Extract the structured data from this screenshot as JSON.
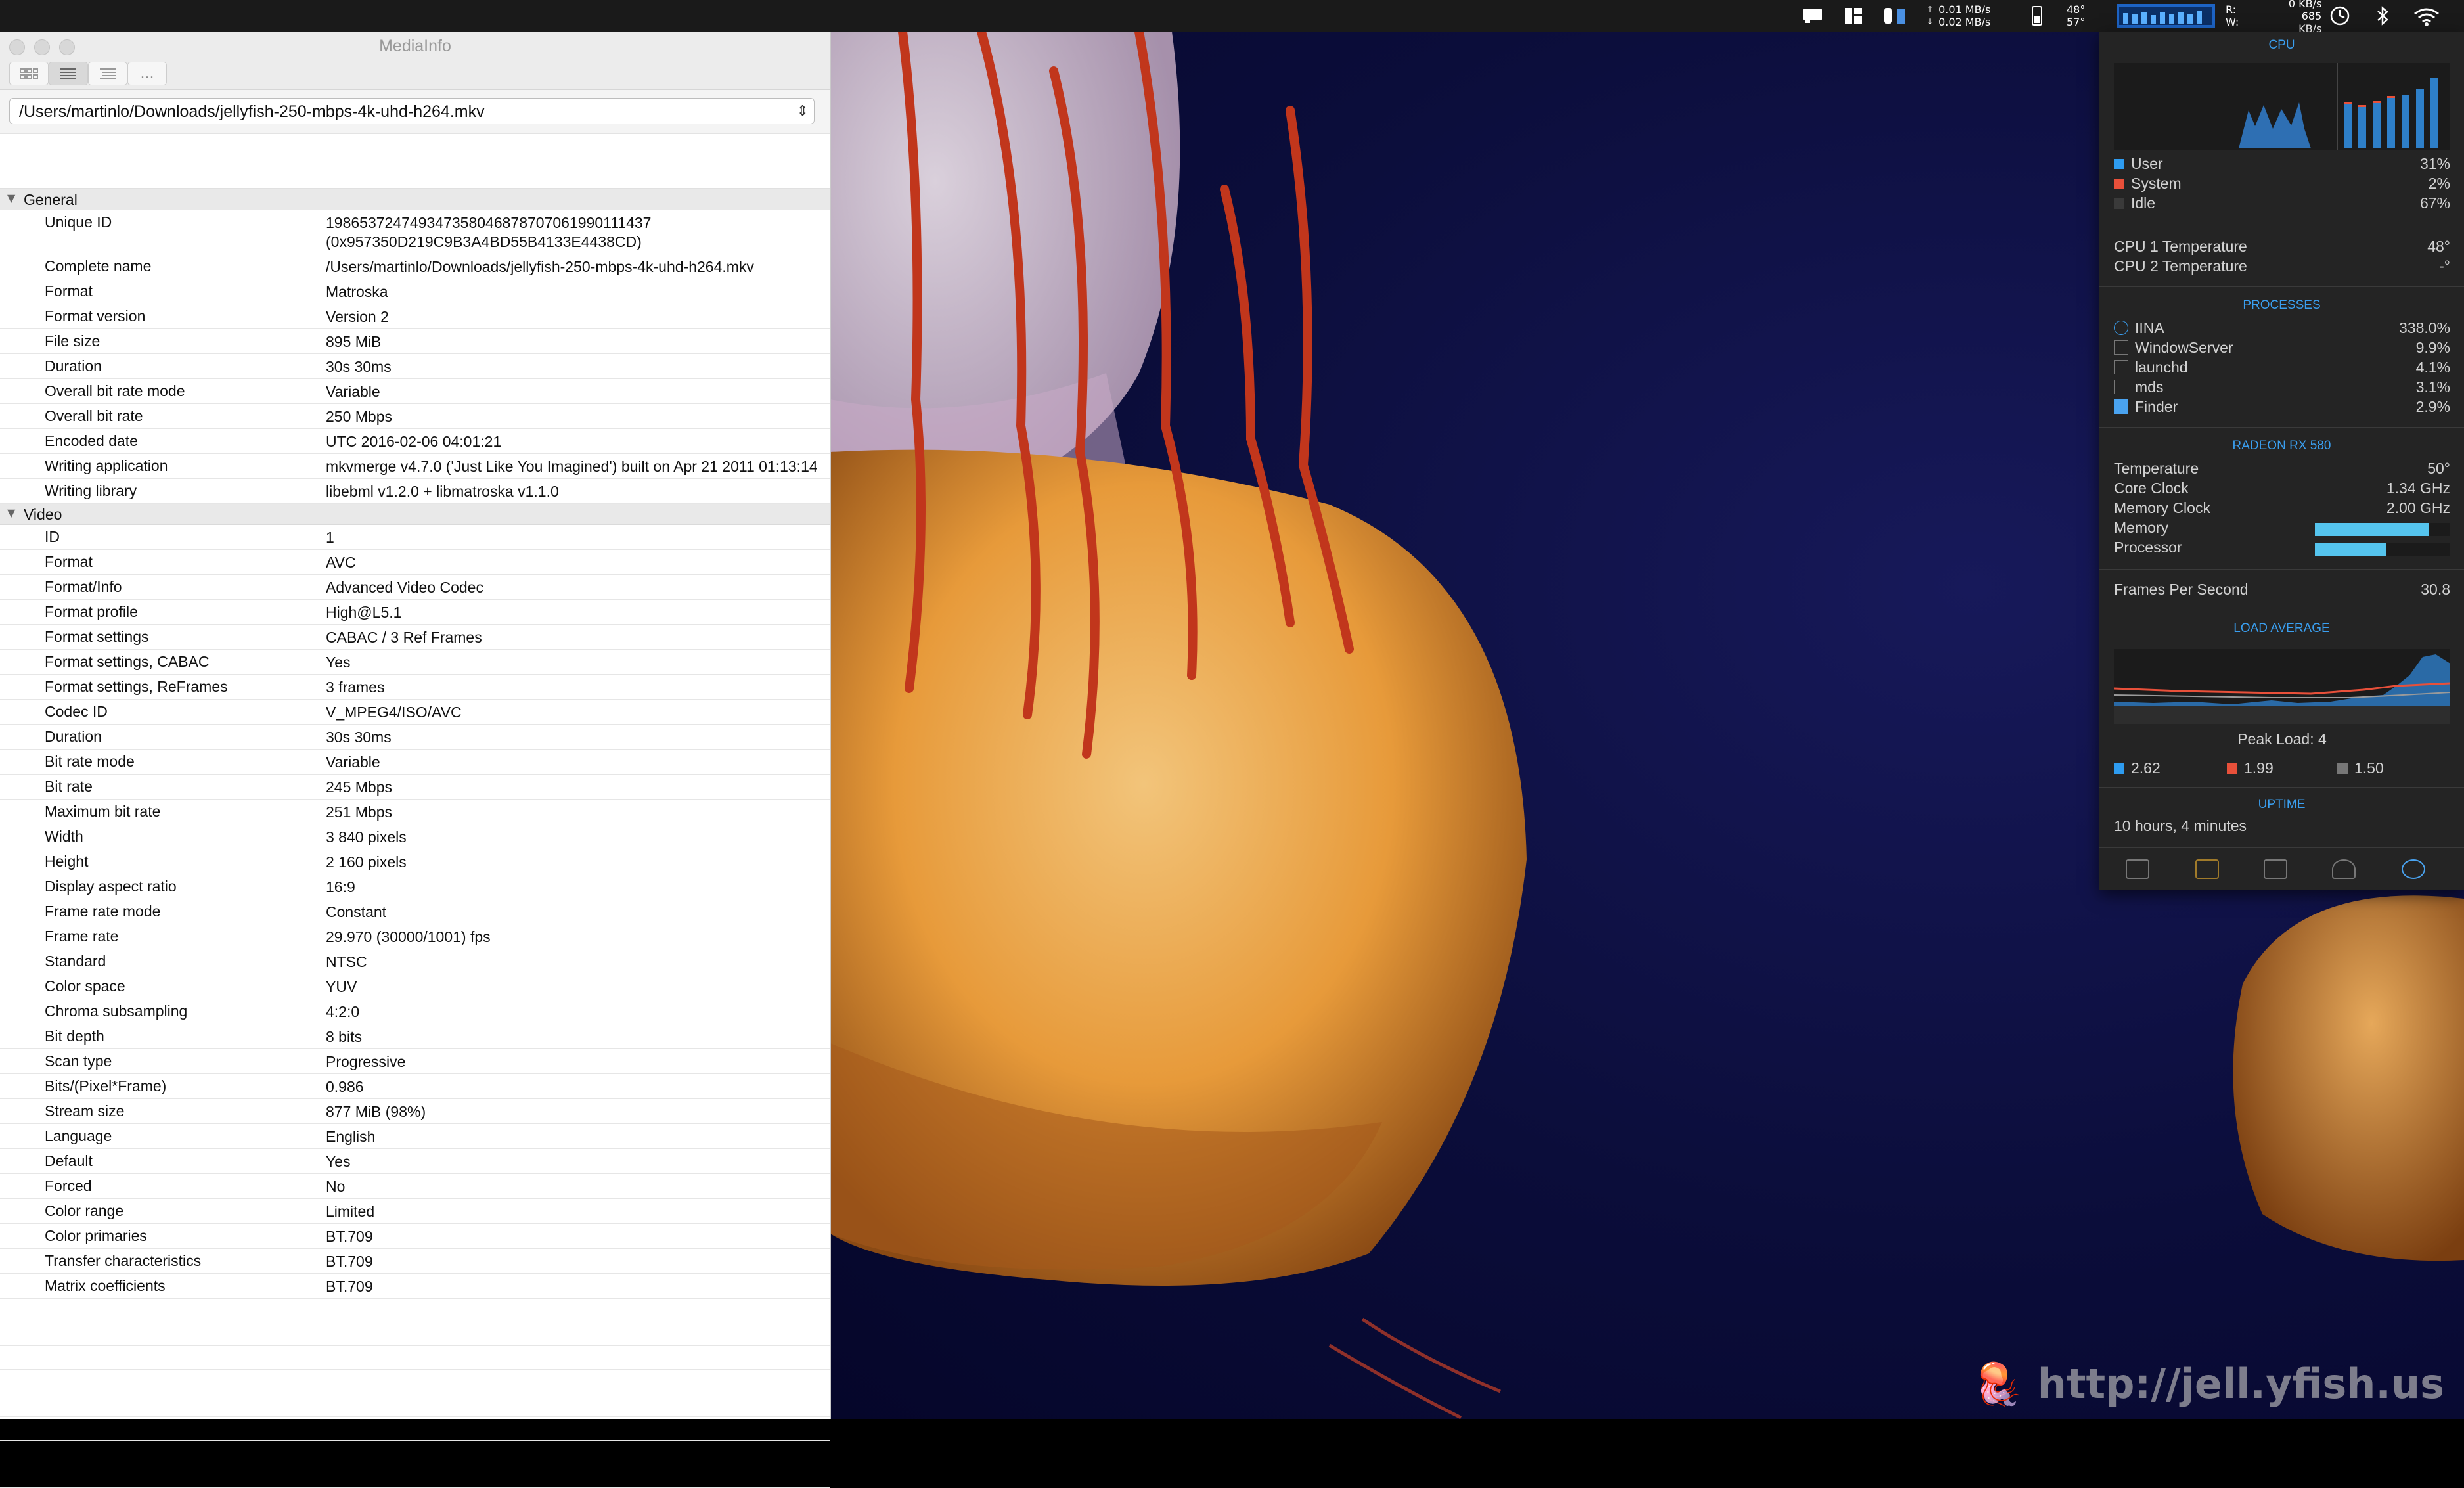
{
  "menubar": {
    "net_up": "0.01 MB/s",
    "net_down": "0.02 MB/s",
    "temp_top": "48°",
    "temp_bottom": "57°",
    "disk_r_label": "R:",
    "disk_w_label": "W:",
    "disk_r": "0 KB/s",
    "disk_w": "685 KB/s"
  },
  "window": {
    "title": "MediaInfo",
    "more_label": "...",
    "file_path": "/Users/martinlo/Downloads/jellyfish-250-mbps-4k-uhd-h264.mkv"
  },
  "general": {
    "label": "General",
    "rows": [
      {
        "k": "Unique ID",
        "v": "198653724749347358046878707061990111437 (0x957350D219C9B3A4BD55B4133E4438CD)"
      },
      {
        "k": "Complete name",
        "v": "/Users/martinlo/Downloads/jellyfish-250-mbps-4k-uhd-h264.mkv"
      },
      {
        "k": "Format",
        "v": "Matroska"
      },
      {
        "k": "Format version",
        "v": "Version 2"
      },
      {
        "k": "File size",
        "v": "895 MiB"
      },
      {
        "k": "Duration",
        "v": "30s 30ms"
      },
      {
        "k": "Overall bit rate mode",
        "v": "Variable"
      },
      {
        "k": "Overall bit rate",
        "v": "250 Mbps"
      },
      {
        "k": "Encoded date",
        "v": "UTC 2016-02-06 04:01:21"
      },
      {
        "k": "Writing application",
        "v": "mkvmerge v4.7.0 ('Just Like You Imagined') built on Apr 21 2011 01:13:14"
      },
      {
        "k": "Writing library",
        "v": "libebml v1.2.0 + libmatroska v1.1.0"
      }
    ]
  },
  "video": {
    "label": "Video",
    "rows": [
      {
        "k": "ID",
        "v": "1"
      },
      {
        "k": "Format",
        "v": "AVC"
      },
      {
        "k": "Format/Info",
        "v": "Advanced Video Codec"
      },
      {
        "k": "Format profile",
        "v": "High@L5.1"
      },
      {
        "k": "Format settings",
        "v": "CABAC / 3 Ref Frames"
      },
      {
        "k": "Format settings, CABAC",
        "v": "Yes"
      },
      {
        "k": "Format settings, ReFrames",
        "v": "3 frames"
      },
      {
        "k": "Codec ID",
        "v": "V_MPEG4/ISO/AVC"
      },
      {
        "k": "Duration",
        "v": "30s 30ms"
      },
      {
        "k": "Bit rate mode",
        "v": "Variable"
      },
      {
        "k": "Bit rate",
        "v": "245 Mbps"
      },
      {
        "k": "Maximum bit rate",
        "v": "251 Mbps"
      },
      {
        "k": "Width",
        "v": "3 840 pixels"
      },
      {
        "k": "Height",
        "v": "2 160 pixels"
      },
      {
        "k": "Display aspect ratio",
        "v": "16:9"
      },
      {
        "k": "Frame rate mode",
        "v": "Constant"
      },
      {
        "k": "Frame rate",
        "v": "29.970 (30000/1001) fps"
      },
      {
        "k": "Standard",
        "v": "NTSC"
      },
      {
        "k": "Color space",
        "v": "YUV"
      },
      {
        "k": "Chroma subsampling",
        "v": "4:2:0"
      },
      {
        "k": "Bit depth",
        "v": "8 bits"
      },
      {
        "k": "Scan type",
        "v": "Progressive"
      },
      {
        "k": "Bits/(Pixel*Frame)",
        "v": "0.986"
      },
      {
        "k": "Stream size",
        "v": "877 MiB (98%)"
      },
      {
        "k": "Language",
        "v": "English"
      },
      {
        "k": "Default",
        "v": "Yes"
      },
      {
        "k": "Forced",
        "v": "No"
      },
      {
        "k": "Color range",
        "v": "Limited"
      },
      {
        "k": "Color primaries",
        "v": "BT.709"
      },
      {
        "k": "Transfer characteristics",
        "v": "BT.709"
      },
      {
        "k": "Matrix coefficients",
        "v": "BT.709"
      }
    ]
  },
  "stats": {
    "cpu_title": "CPU",
    "cpu": [
      {
        "label": "User",
        "value": "31%",
        "color": "#2e9cf0"
      },
      {
        "label": "System",
        "value": "2%",
        "color": "#e8503a"
      },
      {
        "label": "Idle",
        "value": "67%",
        "color": "#3a3a3a"
      }
    ],
    "temps": [
      {
        "label": "CPU 1 Temperature",
        "value": "48°"
      },
      {
        "label": "CPU 2 Temperature",
        "value": "-°"
      }
    ],
    "processes_title": "PROCESSES",
    "processes": [
      {
        "name": "IINA",
        "value": "338.0%"
      },
      {
        "name": "WindowServer",
        "value": "9.9%"
      },
      {
        "name": "launchd",
        "value": "4.1%"
      },
      {
        "name": "mds",
        "value": "3.1%"
      },
      {
        "name": "Finder",
        "value": "2.9%"
      }
    ],
    "gpu_title": "RADEON RX 580",
    "gpu": [
      {
        "label": "Temperature",
        "value": "50°"
      },
      {
        "label": "Core Clock",
        "value": "1.34 GHz"
      },
      {
        "label": "Memory Clock",
        "value": "2.00 GHz"
      }
    ],
    "gpu_memory_label": "Memory",
    "gpu_memory_level": 0.84,
    "gpu_processor_label": "Processor",
    "gpu_processor_level": 0.53,
    "fps_label": "Frames Per Second",
    "fps_value": "30.8",
    "load_title": "LOAD AVERAGE",
    "peak_load": "Peak Load: 4",
    "loads": [
      {
        "value": "2.62",
        "color": "#2e9cf0"
      },
      {
        "value": "1.99",
        "color": "#e8503a"
      },
      {
        "value": "1.50",
        "color": "#777777"
      }
    ],
    "uptime_title": "UPTIME",
    "uptime": "10 hours, 4 minutes"
  },
  "watermark": "http://jell.yfish.us"
}
